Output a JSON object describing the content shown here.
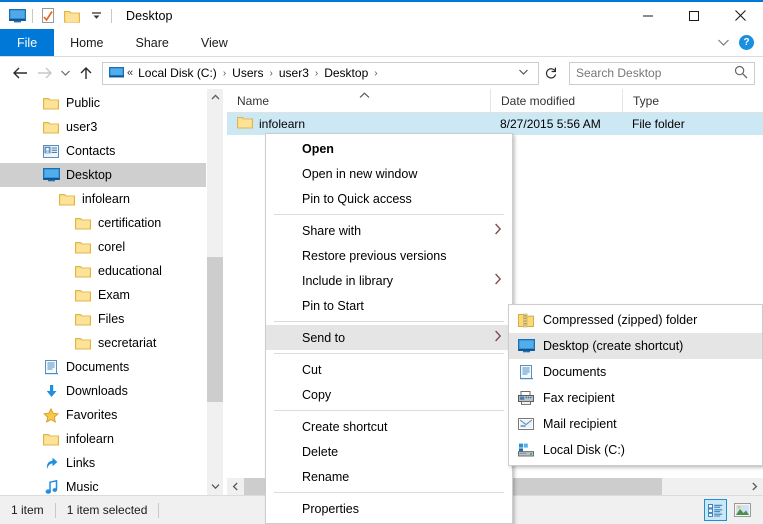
{
  "window": {
    "title": "Desktop",
    "quick_access": [
      "desktop-icon",
      "properties-icon",
      "new-folder-icon",
      "customize-dropdown"
    ],
    "controls": {
      "minimize": "—",
      "maximize": "☐",
      "close": "✕"
    },
    "accent_color": "#0078d7"
  },
  "ribbon": {
    "tabs": [
      {
        "label": "File",
        "active": true
      },
      {
        "label": "Home",
        "active": false
      },
      {
        "label": "Share",
        "active": false
      },
      {
        "label": "View",
        "active": false
      }
    ],
    "collapse_icon": "chevron-down-icon",
    "help_icon": "?"
  },
  "address": {
    "back_icon": "←",
    "forward_icon": "→",
    "recent_icon": "∨",
    "up_icon": "↑",
    "overflow": "«",
    "breadcrumbs": [
      "Local Disk (C:)",
      "Users",
      "user3",
      "Desktop"
    ],
    "separator": "›",
    "history_icon": "∨",
    "refresh_icon": "↻"
  },
  "search": {
    "placeholder": "Search Desktop",
    "value": "",
    "icon": "search-icon"
  },
  "nav_pane": {
    "items": [
      {
        "label": "Public",
        "icon": "folder-icon",
        "indent": 1,
        "selected": false
      },
      {
        "label": "user3",
        "icon": "folder-icon",
        "indent": 1,
        "selected": false
      },
      {
        "label": "Contacts",
        "icon": "contacts-icon",
        "indent": 2,
        "selected": false
      },
      {
        "label": "Desktop",
        "icon": "desktop-icon",
        "indent": 2,
        "selected": true
      },
      {
        "label": "infolearn",
        "icon": "folder-icon",
        "indent": 3,
        "selected": false
      },
      {
        "label": "certification",
        "icon": "folder-icon",
        "indent": 4,
        "selected": false
      },
      {
        "label": "corel",
        "icon": "folder-icon",
        "indent": 4,
        "selected": false
      },
      {
        "label": "educational",
        "icon": "folder-icon",
        "indent": 4,
        "selected": false
      },
      {
        "label": "Exam",
        "icon": "folder-icon",
        "indent": 4,
        "selected": false
      },
      {
        "label": "Files",
        "icon": "folder-icon",
        "indent": 4,
        "selected": false
      },
      {
        "label": "secretariat",
        "icon": "folder-icon",
        "indent": 4,
        "selected": false
      },
      {
        "label": "Documents",
        "icon": "documents-icon",
        "indent": 2,
        "selected": false
      },
      {
        "label": "Downloads",
        "icon": "downloads-icon",
        "indent": 2,
        "selected": false
      },
      {
        "label": "Favorites",
        "icon": "favorites-icon",
        "indent": 2,
        "selected": false
      },
      {
        "label": "infolearn",
        "icon": "folder-icon",
        "indent": 2,
        "selected": false
      },
      {
        "label": "Links",
        "icon": "links-icon",
        "indent": 2,
        "selected": false
      },
      {
        "label": "Music",
        "icon": "music-icon",
        "indent": 2,
        "selected": false
      }
    ]
  },
  "file_list": {
    "columns": [
      {
        "label": "Name",
        "sorted": true,
        "sort_dir": "asc"
      },
      {
        "label": "Date modified",
        "sorted": false
      },
      {
        "label": "Type",
        "sorted": false
      }
    ],
    "rows": [
      {
        "name": "infolearn",
        "date_modified": "8/27/2015 5:56 AM",
        "type": "File folder",
        "selected": true,
        "icon": "folder-icon"
      }
    ]
  },
  "context_menu": {
    "items": [
      {
        "label": "Open",
        "bold": true,
        "submenu": false,
        "highlighted": false
      },
      {
        "label": "Open in new window",
        "bold": false,
        "submenu": false,
        "highlighted": false
      },
      {
        "label": "Pin to Quick access",
        "bold": false,
        "submenu": false,
        "highlighted": false
      },
      {
        "separator": true
      },
      {
        "label": "Share with",
        "bold": false,
        "submenu": true,
        "highlighted": false
      },
      {
        "label": "Restore previous versions",
        "bold": false,
        "submenu": false,
        "highlighted": false
      },
      {
        "label": "Include in library",
        "bold": false,
        "submenu": true,
        "highlighted": false
      },
      {
        "label": "Pin to Start",
        "bold": false,
        "submenu": false,
        "highlighted": false
      },
      {
        "separator": true
      },
      {
        "label": "Send to",
        "bold": false,
        "submenu": true,
        "highlighted": true
      },
      {
        "separator": true
      },
      {
        "label": "Cut",
        "bold": false,
        "submenu": false,
        "highlighted": false
      },
      {
        "label": "Copy",
        "bold": false,
        "submenu": false,
        "highlighted": false
      },
      {
        "separator": true
      },
      {
        "label": "Create shortcut",
        "bold": false,
        "submenu": false,
        "highlighted": false
      },
      {
        "label": "Delete",
        "bold": false,
        "submenu": false,
        "highlighted": false
      },
      {
        "label": "Rename",
        "bold": false,
        "submenu": false,
        "highlighted": false
      },
      {
        "separator": true
      },
      {
        "label": "Properties",
        "bold": false,
        "submenu": false,
        "highlighted": false
      }
    ],
    "submenu_arrow": "›"
  },
  "send_to_submenu": {
    "items": [
      {
        "label": "Compressed (zipped) folder",
        "icon": "zip-folder-icon",
        "highlighted": false
      },
      {
        "label": "Desktop (create shortcut)",
        "icon": "desktop-icon",
        "highlighted": true
      },
      {
        "label": "Documents",
        "icon": "documents-icon",
        "highlighted": false
      },
      {
        "label": "Fax recipient",
        "icon": "fax-icon",
        "highlighted": false
      },
      {
        "label": "Mail recipient",
        "icon": "mail-icon",
        "highlighted": false
      },
      {
        "label": "Local Disk (C:)",
        "icon": "disk-icon",
        "highlighted": false
      }
    ]
  },
  "status_bar": {
    "item_count": "1 item",
    "selection": "1 item selected",
    "views": [
      {
        "name": "details-view",
        "active": true
      },
      {
        "name": "large-icons-view",
        "active": false
      }
    ]
  },
  "scrollbars": {
    "nav_up": "∧",
    "nav_down": "∨",
    "h_left": "‹",
    "h_right": "›"
  }
}
